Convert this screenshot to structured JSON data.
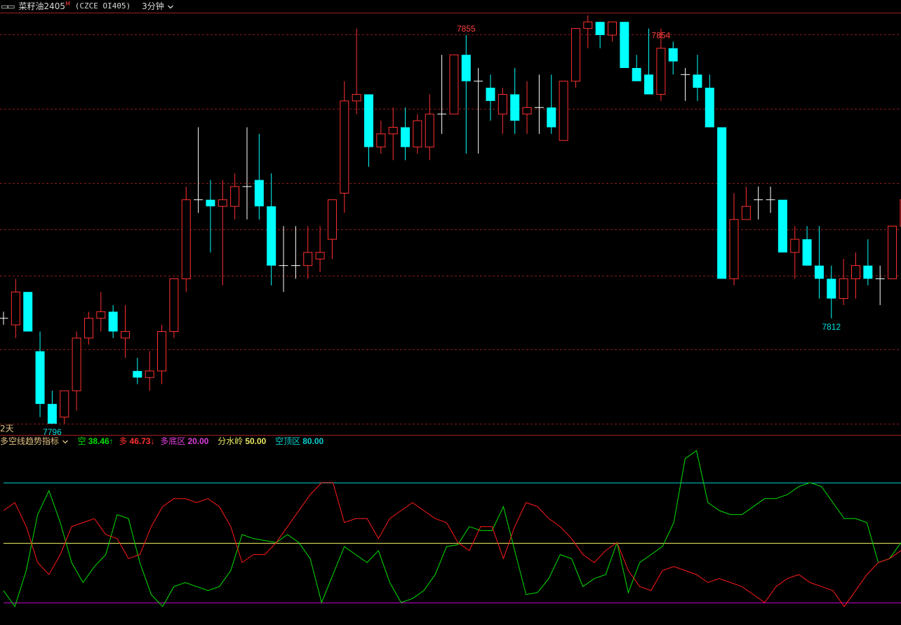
{
  "header": {
    "layout_icon": "layout-icon",
    "symbol_name": "菜籽油2405",
    "symbol_mark": "M",
    "symbol_code": "(CZCE OI405)",
    "period": "3分钟",
    "period_chevron": "chevron-down-icon"
  },
  "timeframe_label": "2天",
  "indicator": {
    "name": "多空线趋势指标",
    "chevron": "chevron-down-icon",
    "kong_label": "空",
    "kong_value": "38.46↑",
    "duo_label": "多",
    "duo_value": "46.73↓",
    "duodi_label": "多底区",
    "duodi_value": "20.00",
    "fenshui_label": "分水岭",
    "fenshui_value": "50.00",
    "kongding_label": "空顶区",
    "kongding_value": "80.00"
  },
  "colors": {
    "up": "#ff3030",
    "down": "#00ffff",
    "flat": "#ffffff",
    "grid": "#8b1a1a",
    "kong_line": "#00e000",
    "duo_line": "#ff1a1a",
    "level_high": "#00c8c8",
    "level_mid": "#e8e860",
    "level_low": "#c000c0",
    "high_label": "#ff4040",
    "low_label": "#00e0e0"
  },
  "chart_data": [
    {
      "type": "candlestick",
      "title": "",
      "y_range": [
        7795,
        7860
      ],
      "annotations": [
        {
          "text": "7855",
          "kind": "high",
          "bar": 38,
          "value": 7855
        },
        {
          "text": "7854",
          "kind": "high",
          "bar": 54,
          "value": 7854
        },
        {
          "text": "7812",
          "kind": "low",
          "bar": 68,
          "value": 7812
        },
        {
          "text": "7796",
          "kind": "low",
          "bar": 4,
          "value": 7796
        }
      ],
      "ohlc": [
        [
          7812,
          7813,
          7811,
          7812
        ],
        [
          7811,
          7818,
          7809,
          7816
        ],
        [
          7816,
          7816,
          7810,
          7810
        ],
        [
          7807,
          7810,
          7797,
          7799
        ],
        [
          7799,
          7801,
          7796,
          7796
        ],
        [
          7797,
          7801,
          7796,
          7801
        ],
        [
          7801,
          7810,
          7798,
          7809
        ],
        [
          7809,
          7813,
          7808,
          7812
        ],
        [
          7812,
          7816,
          7810,
          7813
        ],
        [
          7813,
          7814,
          7809,
          7810
        ],
        [
          7809,
          7814,
          7806,
          7810
        ],
        [
          7804,
          7806,
          7802,
          7803
        ],
        [
          7803,
          7807,
          7801,
          7804
        ],
        [
          7804,
          7811,
          7802,
          7810
        ],
        [
          7810,
          7818,
          7809,
          7818
        ],
        [
          7818,
          7832,
          7816,
          7830
        ],
        [
          7830,
          7841,
          7828,
          7830
        ],
        [
          7830,
          7833,
          7822,
          7829
        ],
        [
          7829,
          7833,
          7817,
          7830
        ],
        [
          7829,
          7834,
          7827,
          7832
        ],
        [
          7832,
          7841,
          7827,
          7832
        ],
        [
          7833,
          7840,
          7827,
          7829
        ],
        [
          7829,
          7834,
          7817,
          7820
        ],
        [
          7820,
          7826,
          7816,
          7820
        ],
        [
          7820,
          7826,
          7818,
          7820
        ],
        [
          7820,
          7826,
          7818,
          7822
        ],
        [
          7821,
          7826,
          7819,
          7822
        ],
        [
          7824,
          7829,
          7821,
          7830
        ],
        [
          7831,
          7848,
          7828,
          7845
        ],
        [
          7845,
          7856,
          7843,
          7846
        ],
        [
          7846,
          7844,
          7835,
          7838
        ],
        [
          7838,
          7842,
          7837,
          7840
        ],
        [
          7840,
          7844,
          7836,
          7841
        ],
        [
          7841,
          7844,
          7836,
          7838
        ],
        [
          7838,
          7843,
          7837,
          7842
        ],
        [
          7838,
          7846,
          7836,
          7843
        ],
        [
          7843,
          7852,
          7840,
          7843
        ],
        [
          7843,
          7852,
          7845,
          7852
        ],
        [
          7852,
          7855,
          7837,
          7848
        ],
        [
          7848,
          7850,
          7837,
          7848
        ],
        [
          7847,
          7849,
          7842,
          7845
        ],
        [
          7843,
          7847,
          7840,
          7846
        ],
        [
          7846,
          7850,
          7840,
          7842
        ],
        [
          7843,
          7848,
          7840,
          7844
        ],
        [
          7844,
          7849,
          7840,
          7844
        ],
        [
          7844,
          7849,
          7840,
          7841
        ],
        [
          7839,
          7847,
          7839,
          7848
        ],
        [
          7848,
          7856,
          7847,
          7856
        ],
        [
          7856,
          7858,
          7853,
          7857
        ],
        [
          7857,
          7857,
          7853,
          7855
        ],
        [
          7855,
          7857,
          7854,
          7857
        ],
        [
          7857,
          7857,
          7850,
          7850
        ],
        [
          7850,
          7852,
          7848,
          7848
        ],
        [
          7849,
          7856,
          7846,
          7846
        ],
        [
          7846,
          7856,
          7845,
          7853
        ],
        [
          7853,
          7854,
          7849,
          7851
        ],
        [
          7849,
          7850,
          7845,
          7849
        ],
        [
          7849,
          7852,
          7845,
          7847
        ],
        [
          7847,
          7849,
          7841,
          7841
        ],
        [
          7841,
          7840,
          7818,
          7818
        ],
        [
          7818,
          7831,
          7817,
          7827
        ],
        [
          7827,
          7832,
          7828,
          7829
        ],
        [
          7830,
          7832,
          7827,
          7830
        ],
        [
          7830,
          7832,
          7828,
          7830
        ],
        [
          7830,
          7828,
          7822,
          7822
        ],
        [
          7822,
          7826,
          7818,
          7824
        ],
        [
          7824,
          7826,
          7820,
          7820
        ],
        [
          7820,
          7826,
          7815,
          7818
        ],
        [
          7818,
          7820,
          7812,
          7815
        ],
        [
          7815,
          7821,
          7814,
          7818
        ],
        [
          7818,
          7822,
          7815,
          7820
        ],
        [
          7820,
          7824,
          7817,
          7818
        ],
        [
          7818,
          7820,
          7814,
          7818
        ],
        [
          7818,
          7825,
          7818,
          7826
        ],
        [
          7826,
          7830,
          7822,
          7830
        ]
      ]
    },
    {
      "type": "line",
      "title": "多空线趋势指标",
      "ylim": [
        20,
        80
      ],
      "levels": [
        {
          "name": "多底区",
          "value": 20
        },
        {
          "name": "分水岭",
          "value": 50
        },
        {
          "name": "空顶区",
          "value": 80
        }
      ],
      "series": [
        {
          "name": "空",
          "values": [
            26,
            18,
            36,
            64,
            76,
            60,
            40,
            30,
            38,
            44,
            64,
            62,
            40,
            24,
            18,
            28,
            30,
            28,
            26,
            28,
            36,
            54,
            52,
            51,
            50,
            54,
            50,
            42,
            20,
            34,
            48,
            44,
            40,
            46,
            30,
            20,
            22,
            26,
            34,
            48,
            49,
            58,
            56,
            56,
            68,
            46,
            24,
            25,
            32,
            44,
            42,
            28,
            32,
            34,
            50,
            25,
            40,
            44,
            48,
            60,
            92,
            96,
            70,
            66,
            64,
            64,
            68,
            72,
            72,
            74,
            78,
            80,
            78,
            70,
            62,
            62,
            60,
            40,
            42,
            50
          ]
        },
        {
          "name": "多",
          "values": [
            66,
            70,
            58,
            40,
            34,
            44,
            58,
            60,
            62,
            54,
            52,
            42,
            44,
            58,
            68,
            72,
            72,
            70,
            72,
            68,
            58,
            40,
            44,
            44,
            50,
            58,
            66,
            74,
            80,
            80,
            60,
            62,
            62,
            52,
            62,
            66,
            70,
            66,
            62,
            60,
            50,
            46,
            58,
            58,
            42,
            58,
            70,
            68,
            62,
            58,
            52,
            44,
            40,
            46,
            50,
            36,
            28,
            26,
            36,
            38,
            36,
            34,
            30,
            32,
            30,
            28,
            24,
            20,
            28,
            32,
            34,
            30,
            28,
            26,
            18,
            26,
            34,
            40,
            42,
            46
          ]
        }
      ]
    }
  ]
}
